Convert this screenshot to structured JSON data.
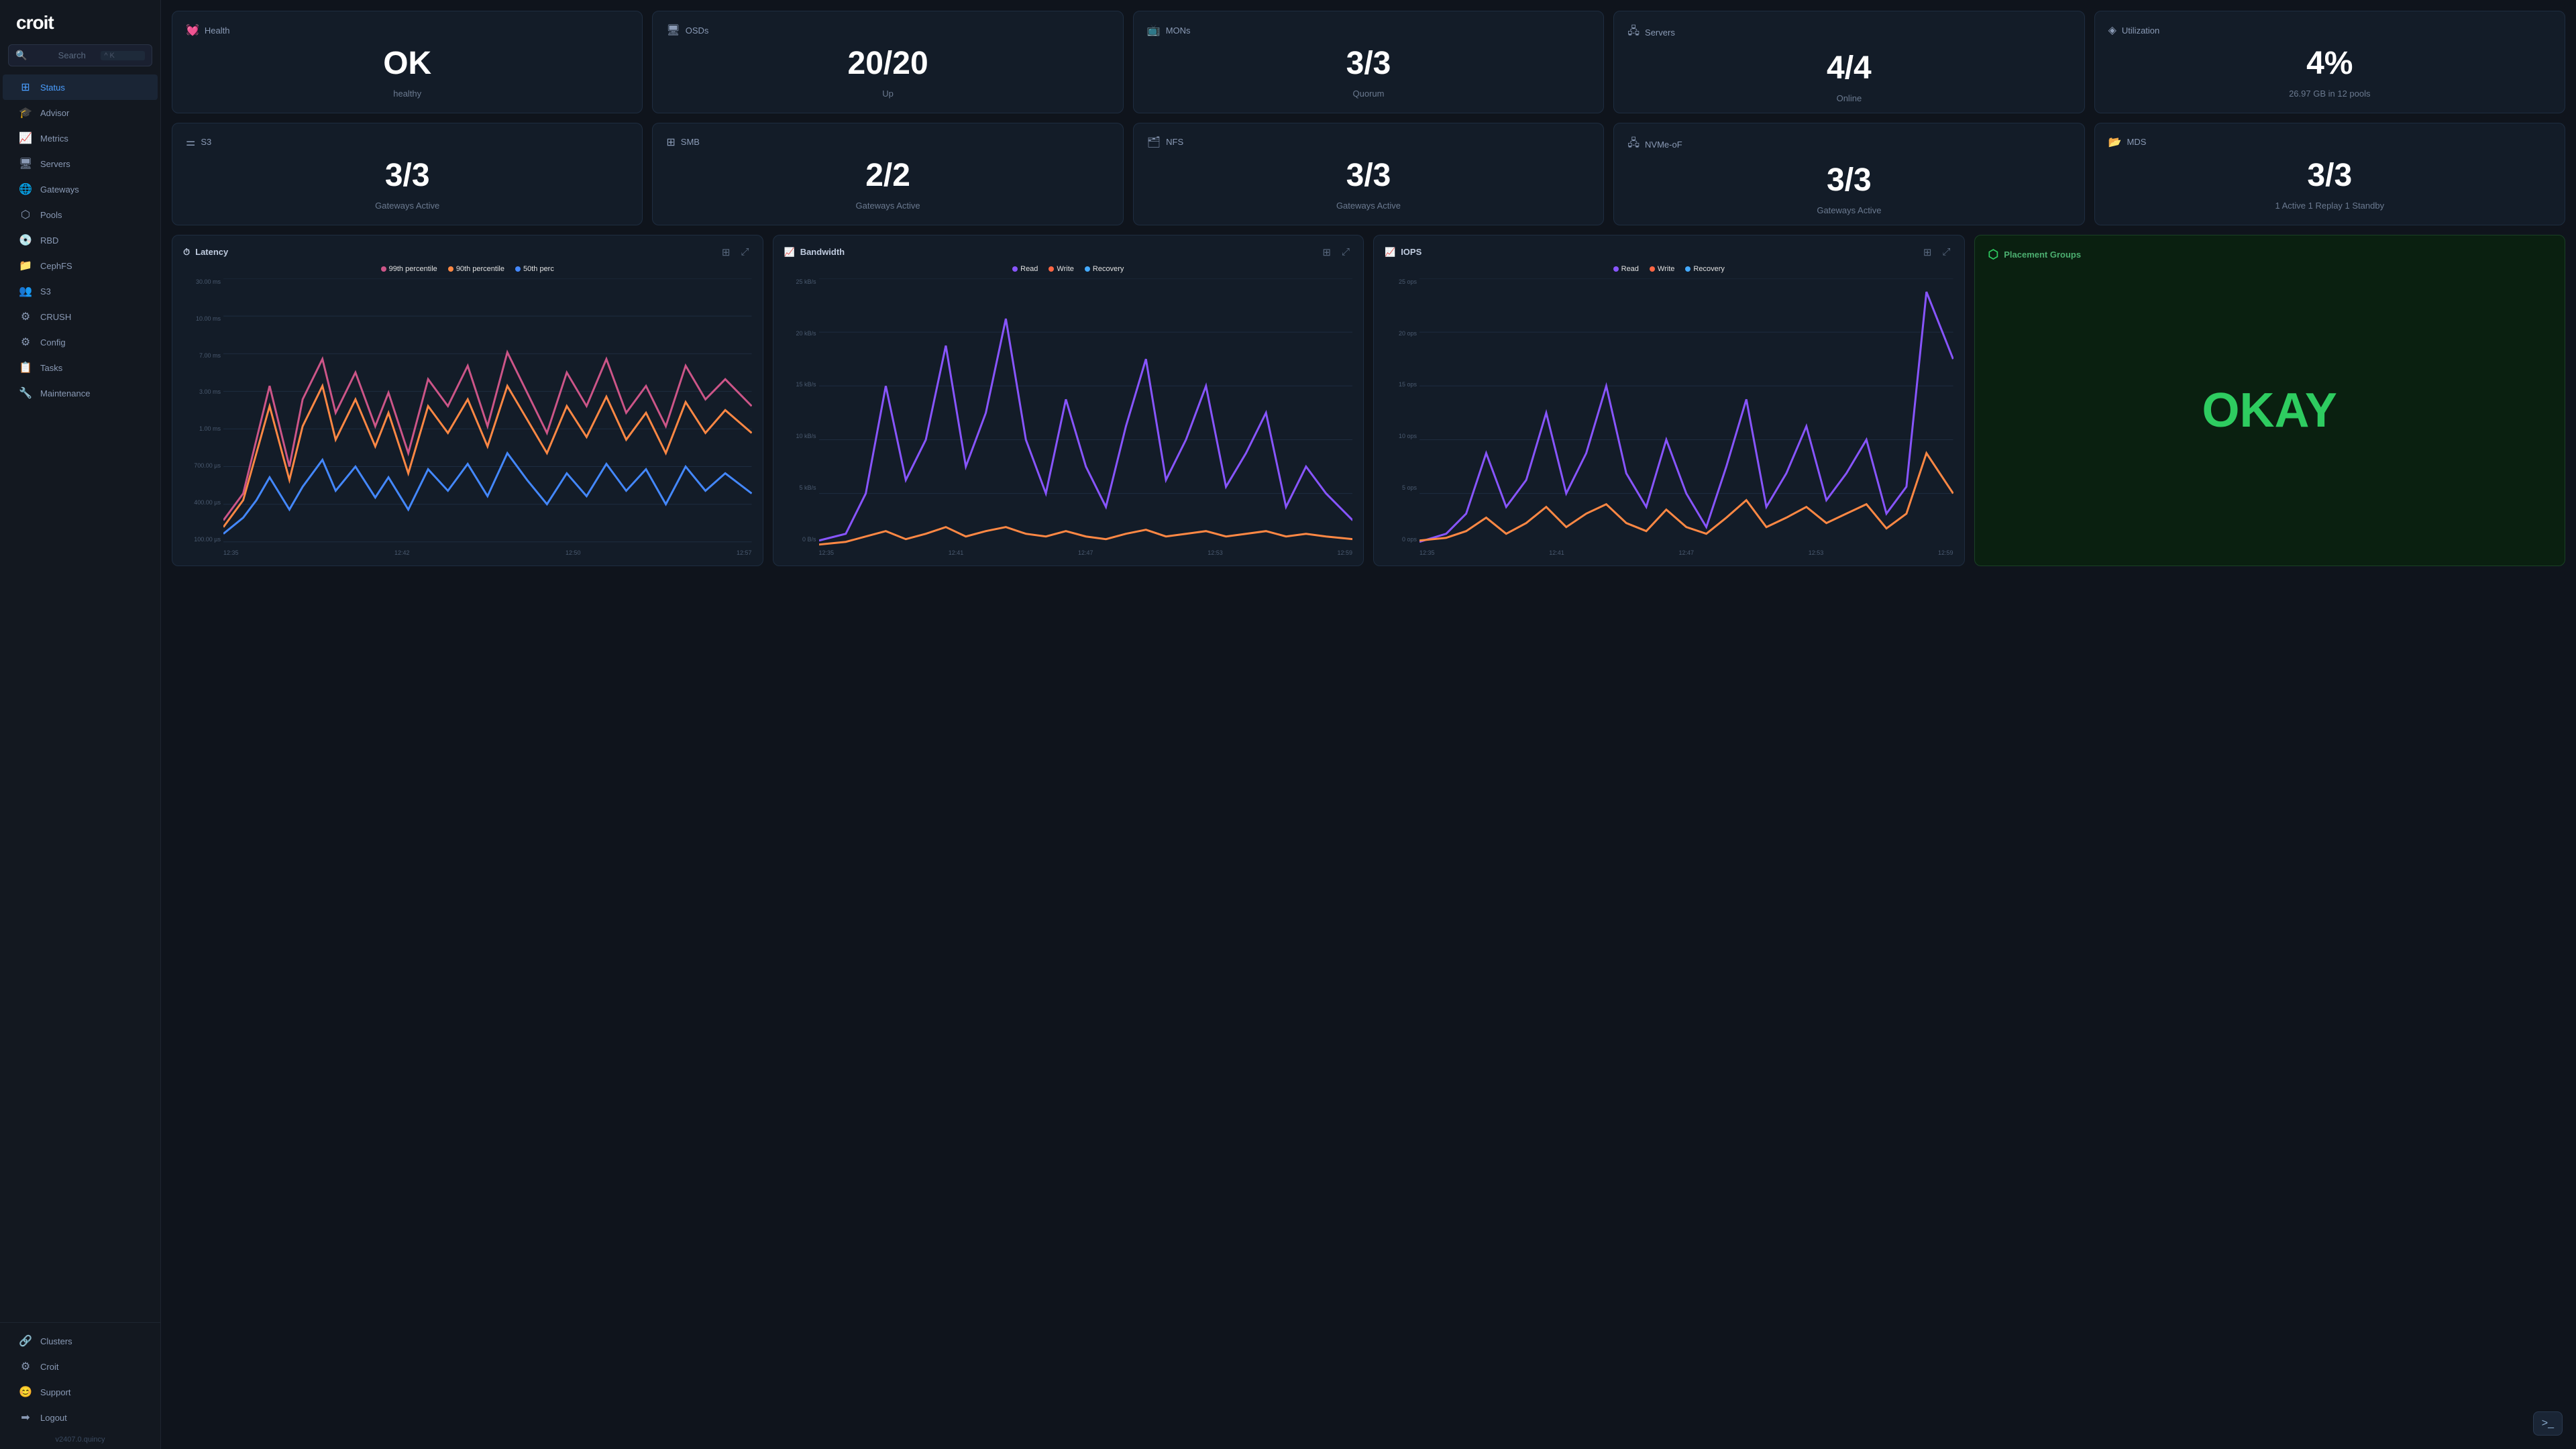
{
  "sidebar": {
    "logo": "croit",
    "search": {
      "placeholder": "Search",
      "shortcut": "^ K"
    },
    "nav_items": [
      {
        "id": "status",
        "label": "Status",
        "icon": "⊞",
        "active": true
      },
      {
        "id": "advisor",
        "label": "Advisor",
        "icon": "🎓"
      },
      {
        "id": "metrics",
        "label": "Metrics",
        "icon": "📈"
      },
      {
        "id": "servers",
        "label": "Servers",
        "icon": "🖥"
      },
      {
        "id": "gateways",
        "label": "Gateways",
        "icon": "🌐"
      },
      {
        "id": "pools",
        "label": "Pools",
        "icon": "⬡"
      },
      {
        "id": "rbd",
        "label": "RBD",
        "icon": "💿"
      },
      {
        "id": "cephfs",
        "label": "CephFS",
        "icon": "📁"
      },
      {
        "id": "s3",
        "label": "S3",
        "icon": "👥"
      },
      {
        "id": "crush",
        "label": "CRUSH",
        "icon": "⚙"
      },
      {
        "id": "config",
        "label": "Config",
        "icon": "⚙"
      },
      {
        "id": "tasks",
        "label": "Tasks",
        "icon": "📋"
      },
      {
        "id": "maintenance",
        "label": "Maintenance",
        "icon": "🔧"
      }
    ],
    "bottom_items": [
      {
        "id": "clusters",
        "label": "Clusters",
        "icon": "🔗"
      },
      {
        "id": "croit",
        "label": "Croit",
        "icon": "⚙"
      },
      {
        "id": "support",
        "label": "Support",
        "icon": "😊"
      },
      {
        "id": "logout",
        "label": "Logout",
        "icon": "➡"
      }
    ],
    "version": "v2407.0.quincy"
  },
  "stats_row1": [
    {
      "id": "health",
      "icon": "💓",
      "label": "Health",
      "value": "OK",
      "sub": "healthy"
    },
    {
      "id": "osds",
      "icon": "🖥",
      "label": "OSDs",
      "value": "20/20",
      "sub": "Up"
    },
    {
      "id": "mons",
      "icon": "📺",
      "label": "MONs",
      "value": "3/3",
      "sub": "Quorum"
    },
    {
      "id": "servers",
      "icon": "🖧",
      "label": "Servers",
      "value": "4/4",
      "sub": "Online"
    },
    {
      "id": "utilization",
      "icon": "◈",
      "label": "Utilization",
      "value": "4%",
      "sub": "26.97 GB in 12 pools"
    }
  ],
  "stats_row2": [
    {
      "id": "s3",
      "icon": "⚌",
      "label": "S3",
      "value": "3/3",
      "sub": "Gateways Active"
    },
    {
      "id": "smb",
      "icon": "⊞",
      "label": "SMB",
      "value": "2/2",
      "sub": "Gateways Active"
    },
    {
      "id": "nfs",
      "icon": "🗂",
      "label": "NFS",
      "value": "3/3",
      "sub": "Gateways Active"
    },
    {
      "id": "nvmeof",
      "icon": "🖧",
      "label": "NVMe-oF",
      "value": "3/3",
      "sub": "Gateways Active"
    },
    {
      "id": "mds",
      "icon": "📂",
      "label": "MDS",
      "value": "3/3",
      "sub": "1 Active 1 Replay 1 Standby"
    }
  ],
  "charts": {
    "latency": {
      "title": "Latency",
      "icon": "⏱",
      "legend": [
        {
          "label": "99th percentile",
          "color": "#cc5588"
        },
        {
          "label": "90th percentile",
          "color": "#ff8844"
        },
        {
          "label": "50th perc",
          "color": "#4488ff"
        }
      ],
      "y_labels": [
        "30.00 ms",
        "10.00 ms",
        "7.00 ms",
        "3.00 ms",
        "1.00 ms",
        "700.00 µs",
        "400.00 µs",
        "100.00 µs"
      ],
      "x_labels": [
        "12:35",
        "12:42",
        "12:50",
        "12:57"
      ]
    },
    "bandwidth": {
      "title": "Bandwidth",
      "icon": "📈",
      "legend": [
        {
          "label": "Read",
          "color": "#8855ff"
        },
        {
          "label": "Write",
          "color": "#ff6644"
        },
        {
          "label": "Recovery",
          "color": "#44aaff"
        }
      ],
      "y_labels": [
        "25 kB/s",
        "20 kB/s",
        "15 kB/s",
        "10 kB/s",
        "5 kB/s",
        "0 B/s"
      ],
      "x_labels": [
        "12:35",
        "12:41",
        "12:47",
        "12:53",
        "12:59"
      ]
    },
    "iops": {
      "title": "IOPS",
      "icon": "📈",
      "legend": [
        {
          "label": "Read",
          "color": "#8855ff"
        },
        {
          "label": "Write",
          "color": "#ff6644"
        },
        {
          "label": "Recovery",
          "color": "#44aaff"
        }
      ],
      "y_labels": [
        "25 ops",
        "20 ops",
        "15 ops",
        "10 ops",
        "5 ops",
        "0 ops"
      ],
      "x_labels": [
        "12:35",
        "12:41",
        "12:47",
        "12:53",
        "12:59"
      ]
    }
  },
  "placement_groups": {
    "title": "Placement Groups",
    "value": "OKAY",
    "icon": "⬡"
  },
  "toolbar": {
    "table_icon": "⊞",
    "expand_icon": "⤢",
    "terminal_icon": ">_"
  }
}
